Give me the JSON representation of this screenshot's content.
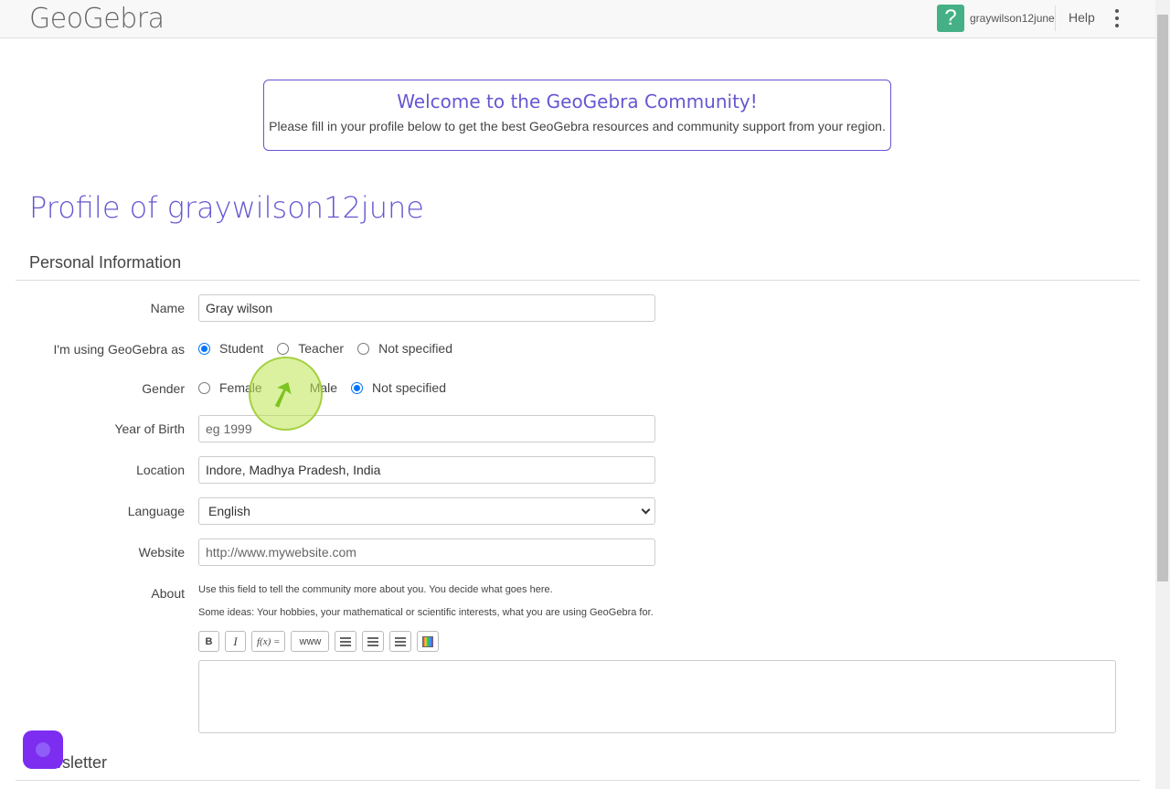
{
  "header": {
    "logo_text": "GeoGebra",
    "help_icon_glyph": "?",
    "username": "graywilson12june",
    "help_label": "Help"
  },
  "welcome": {
    "title": "Welcome to the GeoGebra Community!",
    "message": "Please fill in your profile below to get the best GeoGebra resources and community support from your region."
  },
  "page_title": "Profile of graywilson12june",
  "personal_section": {
    "title": "Personal Information",
    "name": {
      "label": "Name",
      "value": "Gray wilson"
    },
    "using_as": {
      "label": "I'm using GeoGebra as",
      "options": [
        "Student",
        "Teacher",
        "Not specified"
      ],
      "selected": "Student"
    },
    "gender": {
      "label": "Gender",
      "options": [
        "Female",
        "Male",
        "Not specified"
      ],
      "selected": "Not specified"
    },
    "year_of_birth": {
      "label": "Year of Birth",
      "value": "",
      "placeholder": "eg 1999"
    },
    "location": {
      "label": "Location",
      "value": "Indore, Madhya Pradesh, India"
    },
    "language": {
      "label": "Language",
      "selected": "English"
    },
    "website": {
      "label": "Website",
      "value": "",
      "placeholder": "http://www.mywebsite.com"
    },
    "about": {
      "label": "About",
      "hint1": "Use this field to tell the community more about you. You decide what goes here.",
      "hint2": "Some ideas: Your hobbies, your mathematical or scientific interests, what you are using GeoGebra for.",
      "toolbar": {
        "bold": "B",
        "italic": "I",
        "formula": "f(x) =",
        "link": "www"
      },
      "value": ""
    }
  },
  "newsletter_section": {
    "title": "Newsletter"
  },
  "colors": {
    "accent": "#6557d2",
    "help_green": "#45b085",
    "radio_blue": "#0075ff",
    "chat_purple": "#7c2df0"
  }
}
